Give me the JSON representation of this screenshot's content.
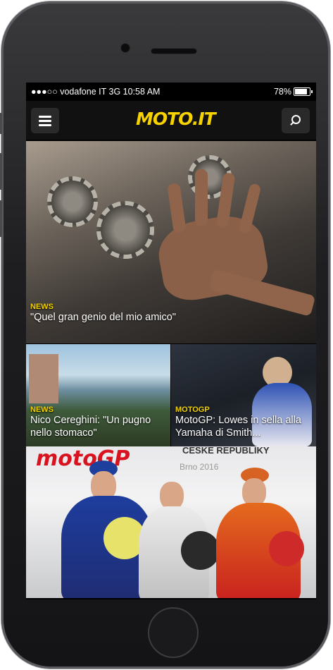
{
  "status": {
    "carrier": "●●●○○ vodafone IT  3G",
    "time": "10:58 AM",
    "battery": "78%",
    "battery_level": 0.78
  },
  "navbar": {
    "logo_text": "MOTO.IT",
    "brand_color": "#f6d300",
    "menu_icon": "hamburger-menu-icon",
    "search_icon": "search-icon"
  },
  "articles": [
    {
      "category": "NEWS",
      "title": "\"Quel gran genio del mio amico\""
    },
    {
      "category": "NEWS",
      "title": "Nico Cereghini: \"Un pugno nello stomaco\""
    },
    {
      "category": "MOTOGP",
      "title": "MotoGP: Lowes in sella alla Yamaha di Smith..."
    }
  ],
  "bottom_card": {
    "banner_text": "motoGP",
    "subbanner_text": "CESKE REPUBLIKY",
    "event_text": "Brno 2016"
  }
}
